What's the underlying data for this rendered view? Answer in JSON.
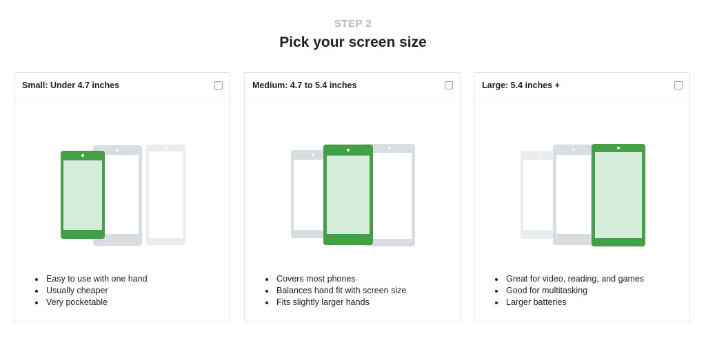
{
  "header": {
    "step": "STEP 2",
    "title": "Pick your screen size"
  },
  "colors": {
    "accent_green": "#43a047",
    "screen_green": "#d4ecd9",
    "phone_gray": "#d8dde1",
    "phone_light": "#eaedf0"
  },
  "cards": [
    {
      "label": "Small: Under 4.7 inches",
      "checked": false,
      "features": [
        "Easy to use with one hand",
        "Usually cheaper",
        "Very pocketable"
      ]
    },
    {
      "label": "Medium: 4.7 to 5.4 inches",
      "checked": false,
      "features": [
        "Covers most phones",
        "Balances hand fit with screen size",
        "Fits slightly larger hands"
      ]
    },
    {
      "label": "Large: 5.4 inches +",
      "checked": false,
      "features": [
        "Great for video, reading, and games",
        "Good for multitasking",
        "Larger batteries"
      ]
    }
  ]
}
